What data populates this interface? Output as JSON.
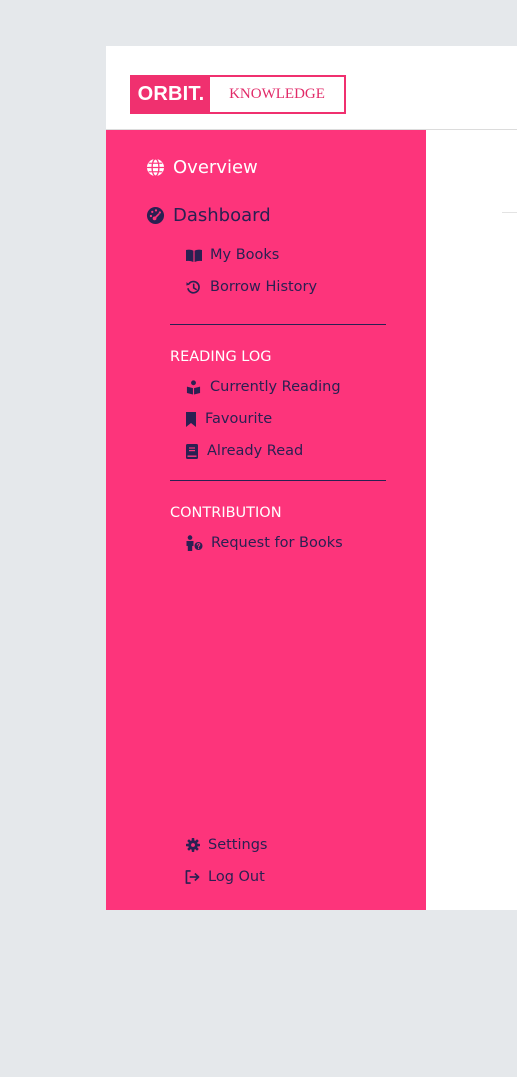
{
  "logo": {
    "brand": "ORBIT.",
    "product": "KNOWLEDGE"
  },
  "colors": {
    "sidebar_bg": "#fd347b",
    "active_text": "#ffffff",
    "nav_text": "#2a2052",
    "logo_accent": "#f0306f",
    "page_bg": "#e5e8eb"
  },
  "nav": {
    "overview": {
      "label": "Overview",
      "icon": "globe-icon"
    },
    "dashboard": {
      "label": "Dashboard",
      "icon": "gauge-icon"
    },
    "dashboard_items": [
      {
        "label": "My Books",
        "icon": "open-book-icon"
      },
      {
        "label": "Borrow History",
        "icon": "history-icon"
      }
    ]
  },
  "reading_log": {
    "heading": "READING LOG",
    "items": [
      {
        "label": "Currently Reading",
        "icon": "person-reading-icon"
      },
      {
        "label": "Favourite",
        "icon": "bookmark-icon"
      },
      {
        "label": "Already Read",
        "icon": "book-icon"
      }
    ]
  },
  "contribution": {
    "heading": "CONTRIBUTION",
    "items": [
      {
        "label": "Request for Books",
        "icon": "person-question-icon"
      }
    ]
  },
  "footer_nav": [
    {
      "label": "Settings",
      "icon": "gear-icon"
    },
    {
      "label": "Log Out",
      "icon": "logout-icon"
    }
  ]
}
